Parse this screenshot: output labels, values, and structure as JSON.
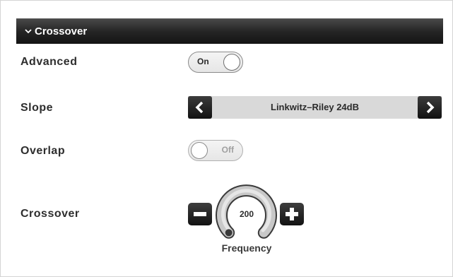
{
  "section": {
    "title": "Crossover",
    "chevron_icon": "chevron-down-icon"
  },
  "advanced": {
    "label": "Advanced",
    "toggle_text": "On",
    "state": "on"
  },
  "slope": {
    "label": "Slope",
    "value": "Linkwitz–Riley 24dB",
    "prev_icon": "chevron-left-icon",
    "next_icon": "chevron-right-icon"
  },
  "overlap": {
    "label": "Overlap",
    "toggle_text": "Off",
    "state": "off"
  },
  "crossover": {
    "label": "Crossover",
    "value": "200",
    "caption": "Frequency",
    "decrease_icon": "minus-icon",
    "increase_icon": "plus-icon"
  },
  "colors": {
    "header_bg": "#1a1a1a",
    "button_bg": "#1c1c1c",
    "selector_bg": "#d9d9d9",
    "dial_ring": "#c4c4c4",
    "dial_outline": "#3a3a3a"
  }
}
